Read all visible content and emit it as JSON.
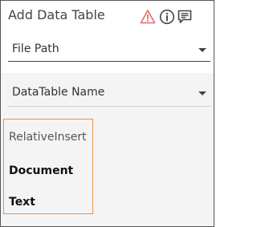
{
  "panel": {
    "title": "Add Data Table",
    "icons": [
      "warning-icon",
      "info-icon",
      "comment-icon"
    ],
    "warning_color": "#e36b6b"
  },
  "fields": {
    "file_path": {
      "label": "File Path"
    },
    "datatable_name": {
      "label": "DataTable Name"
    }
  },
  "dropdown": {
    "options": [
      "RelativeInsert",
      "Document",
      "Text"
    ],
    "highlight_color": "#e9934a"
  }
}
